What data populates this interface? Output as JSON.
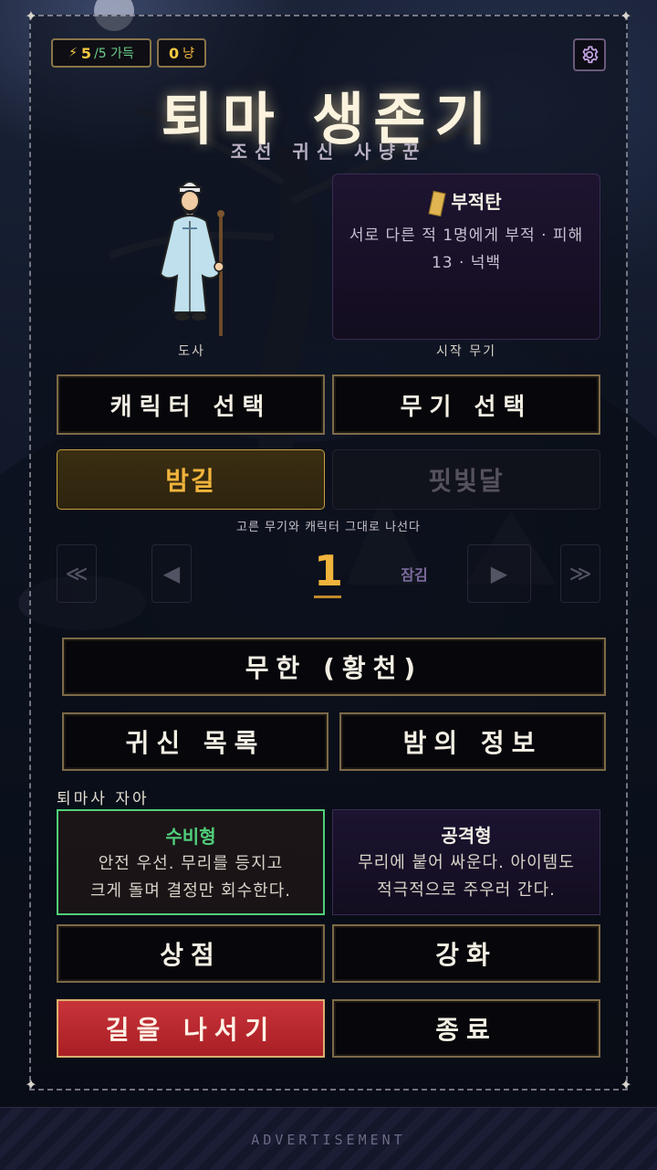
{
  "hud": {
    "stamina_icon": "lightning-icon",
    "stamina_current": "5",
    "stamina_max_text": "/5 가득",
    "gold_value": "0",
    "gold_unit": "냥",
    "settings_icon": "gear-icon"
  },
  "title": "퇴마 생존기",
  "subtitle": "조선 귀신 사냥꾼",
  "character": {
    "name": "도사",
    "portrait": "old-taoist-monk-with-staff"
  },
  "weapon": {
    "icon": "talisman-icon",
    "name": "부적탄",
    "description": "서로 다른 적 1명에게 부적 · 피해 13 · 넉백",
    "caption": "시작 무기"
  },
  "select_buttons": {
    "character": "캐릭터 선택",
    "weapon": "무기 선택"
  },
  "modes": {
    "active": "밤길",
    "locked": "핏빛달",
    "hint": "고른 무기와 캐릭터 그대로 나선다"
  },
  "stage": {
    "first_label": "≪",
    "prev_label": "◀",
    "number": "1",
    "locked_label": "잠김",
    "next_label": "▶",
    "last_label": "≫"
  },
  "menu": {
    "infinite": "무한 (황천)",
    "ghost_list": "귀신 목록",
    "night_info": "밤의 정보"
  },
  "ego": {
    "label": "퇴마사 자아",
    "defensive": {
      "title": "수비형",
      "desc1": "안전 우선. 무리를 등지고",
      "desc2": "크게 돌며 결정만 회수한다."
    },
    "offensive": {
      "title": "공격형",
      "desc1": "무리에 붙어 싸운다. 아이템도",
      "desc2": "적극적으로 주우러 간다."
    }
  },
  "bottom": {
    "shop": "상점",
    "upgrade": "강화",
    "start": "길을 나서기",
    "quit": "종료"
  },
  "ad": {
    "label": "ADVERTISEMENT"
  },
  "colors": {
    "gold_border": "#7d6a48",
    "accent_gold": "#f0b43c",
    "defensive_green": "#4fcf7a",
    "start_red": "#b8262c",
    "stamina_yellow": "#f5c842"
  }
}
